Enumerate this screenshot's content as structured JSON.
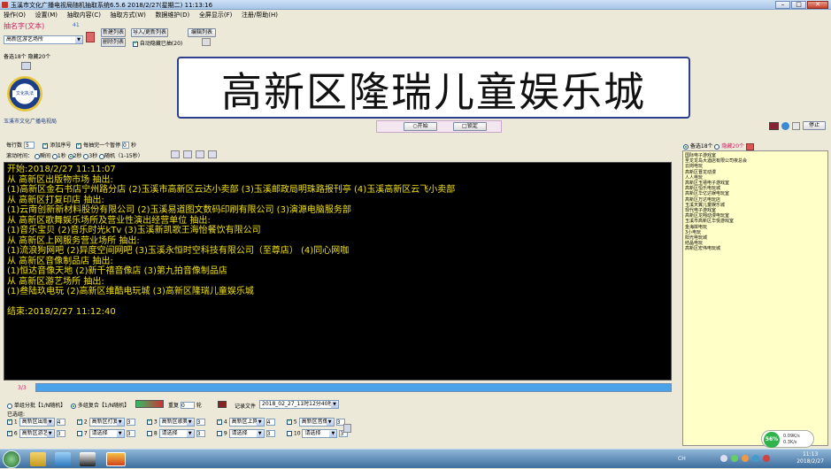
{
  "window": {
    "title": "玉溪市文化广播电视局随机抽取系统6.5.6 2018/2/27(星期二) 11:13:16"
  },
  "menu": [
    "操作(O)",
    "设置(M)",
    "抽取内容(C)",
    "抽取方式(W)",
    "数据维护(D)",
    "全屏显示(F)",
    "注册/帮助(H)"
  ],
  "left": {
    "header_label": "抽名字(文本)",
    "header_num": "41",
    "current_list": "高新区游艺场所",
    "btn_new_list": "新建列表",
    "btn_import_export": "导入/更新列表",
    "btn_edit_list": "编辑列表",
    "btn_delete_list": "删除列表",
    "auto_hide_label": "自动隐藏已抽(20)",
    "count_text": "备选18个 隐藏20个",
    "org_name": "玉溪市文化广播电视局",
    "logo_text": "文化执法"
  },
  "display": {
    "text": "高新区隆瑞儿童娱乐城"
  },
  "controls": {
    "start_label": "○开始",
    "lock_label": "□锁定",
    "stop_label": "停止",
    "per_line_label": "每行数",
    "per_line_value": "5",
    "add_number_label": "添加序号",
    "pause_label": "每抽完一个暂停",
    "pause_value": "0",
    "pause_unit": "秒",
    "scroll_label": "滚动时间：",
    "scroll_options": [
      "瞬间",
      "1秒",
      "2秒",
      "3秒",
      "随机（1-15秒）"
    ],
    "scroll_selected": 2
  },
  "console": {
    "lines": [
      "开始:2018/2/27 11:11:07",
      "从 高新区出版物市场 抽出:",
      " (1)高新区金石书店宁州路分店  (2)玉溪市高新区云达小卖部  (3)玉溪邮政局明珠路报刊亭  (4)玉溪高新区云飞小卖部",
      "从 高新区打复印店 抽出:",
      " (1)云南创新新材料股份有限公司  (2)玉溪易道图文数码印刷有限公司  (3)演源电脑服务部",
      "从 高新区歌舞娱乐场所及营业性演出经营单位 抽出:",
      " (1)音乐宝贝  (2)音乐时光kTv  (3)玉溪新凯歌王海怡餐饮有限公司",
      "从 高新区上网服务营业场所 抽出:",
      " (1)流浪狗网吧  (2)异度空间网吧  (3)玉溪永恒时空科技有限公司（至尊店）  (4)同心网咖",
      "从 高新区音像制品店 抽出:",
      " (1)恒达音像天地  (2)新千禧音像店  (3)第九拍音像制品店",
      "从 高新区游艺场所 抽出:",
      " (1)叁陆玖电玩  (2)高新区维酷电玩城  (3)高新区隆瑞儿童娱乐城",
      "",
      "结束:2018/2/27 11:12:40"
    ]
  },
  "right": {
    "filter_label1": "备选18个",
    "filter_label2": "隐藏20个",
    "items": [
      "国际电子游戏室",
      "圣龙龙岛大酒店有限公司夜总会",
      "云岗电玩",
      "高新区晋龙动漫",
      "人人电玩",
      "高新区玉禧电子游戏室",
      "高新区恒乐电玩城",
      "高新区华亿达娱电玩室",
      "高新区万达电玩店",
      "玉溪天翼儿童娱乐城",
      "现代电子游戏室",
      "高新区龙翔动漫电玩室",
      "玉溪市高新区华悦游戏室",
      "金海岸电玩",
      "3小电玩",
      "阳光电玩城",
      "结晶电玩",
      "高新区宏伟电玩城"
    ]
  },
  "bottom": {
    "progress_text": "3/3",
    "progress_fraction": 1.0,
    "mode_single": "单组分批【1/N随机】",
    "mode_multi": "多组复合【1/N随机】",
    "repeat_label": "重复",
    "repeat_value": "0",
    "rounds_label": "轮",
    "record_label": "记录文件",
    "record_file": "2018_02_27_11时12分40秒",
    "selected_label": "已选组:",
    "groups": [
      {
        "n": "1",
        "name": "高新区出版",
        "count": "4",
        "checked": true
      },
      {
        "n": "2",
        "name": "高新区打复",
        "count": "3",
        "checked": true
      },
      {
        "n": "3",
        "name": "高新区歌舞",
        "count": "3",
        "checked": true
      },
      {
        "n": "4",
        "name": "高新区上网",
        "count": "4",
        "checked": true
      },
      {
        "n": "5",
        "name": "高新区音像",
        "count": "3",
        "checked": true
      },
      {
        "n": "6",
        "name": "高新区游艺",
        "count": "3",
        "checked": true
      },
      {
        "n": "7",
        "name": "请选择",
        "count": "3",
        "checked": false
      },
      {
        "n": "8",
        "name": "请选择",
        "count": "3",
        "checked": false
      },
      {
        "n": "9",
        "name": "请选择",
        "count": "3",
        "checked": false
      },
      {
        "n": "10",
        "name": "请选择",
        "count": "3",
        "checked": false
      }
    ]
  },
  "status": {
    "percent": "56%",
    "up": "0.09K/s",
    "down": "0.3K/s"
  },
  "taskbar": {
    "lang": "CH",
    "time": "11:13",
    "date": "2018/2/27"
  }
}
